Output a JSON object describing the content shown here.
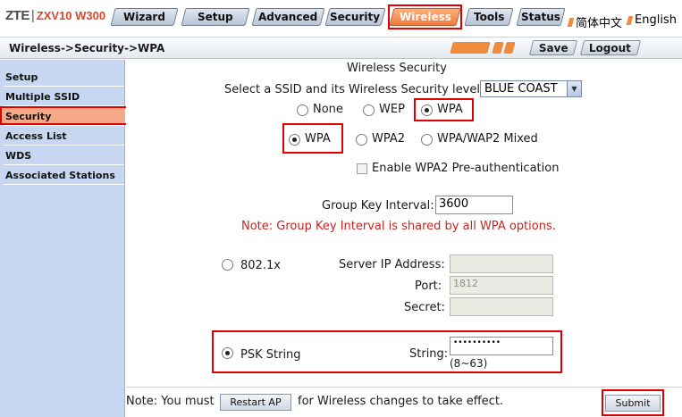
{
  "header": {
    "brand": "ZTE",
    "separator": "|",
    "model": "ZXV10 W300",
    "tabs": [
      {
        "label": "Wizard"
      },
      {
        "label": "Setup"
      },
      {
        "label": "Advanced"
      },
      {
        "label": "Security"
      },
      {
        "label": "Wireless"
      },
      {
        "label": "Tools"
      },
      {
        "label": "Status"
      }
    ],
    "active_tab": "Wireless",
    "languages": [
      "简体中文",
      "English"
    ]
  },
  "breadcrumb": "Wireless->Security->WPA",
  "actions": {
    "save": "Save",
    "logout": "Logout"
  },
  "sidebar": {
    "items": [
      {
        "label": "Setup"
      },
      {
        "label": "Multiple SSID"
      },
      {
        "label": "Security"
      },
      {
        "label": "Access List"
      },
      {
        "label": "WDS"
      },
      {
        "label": "Associated Stations"
      }
    ],
    "active": "Security"
  },
  "main": {
    "title": "Wireless Security",
    "ssid_label": "Select a SSID and its Wireless Security level:",
    "ssid_value": "BLUE COAST",
    "security_levels": [
      {
        "label": "None",
        "selected": false
      },
      {
        "label": "WEP",
        "selected": false
      },
      {
        "label": "WPA",
        "selected": true
      }
    ],
    "wpa_modes": [
      {
        "label": "WPA",
        "selected": true
      },
      {
        "label": "WPA2",
        "selected": false
      },
      {
        "label": "WPA/WAP2 Mixed",
        "selected": false
      }
    ],
    "preauth_label": "Enable WPA2 Pre-authentication",
    "preauth_checked": false,
    "group_key_label": "Group Key Interval:",
    "group_key_value": "3600",
    "group_key_note": "Note: Group Key Interval is shared by all WPA options.",
    "radius": {
      "option_label": "802.1x",
      "selected": false,
      "server_ip_label": "Server IP Address:",
      "server_ip_value": "",
      "port_label": "Port:",
      "port_value": "1812",
      "secret_label": "Secret:",
      "secret_value": ""
    },
    "psk": {
      "option_label": "PSK String",
      "selected": true,
      "string_label": "String:",
      "string_value": "••••••••••",
      "hint": "(8~63)"
    },
    "footer_note_prefix": "Note: You must",
    "restart_button": "Restart AP",
    "footer_note_suffix": "for Wireless changes to take effect.",
    "submit_button": "Submit"
  },
  "colors": {
    "accent_orange": "#f08a3c",
    "highlight_red": "#e00000",
    "sidebar_bg": "#c7d7f1",
    "sidebar_active": "#f6a986",
    "note_red": "#c7241f"
  }
}
